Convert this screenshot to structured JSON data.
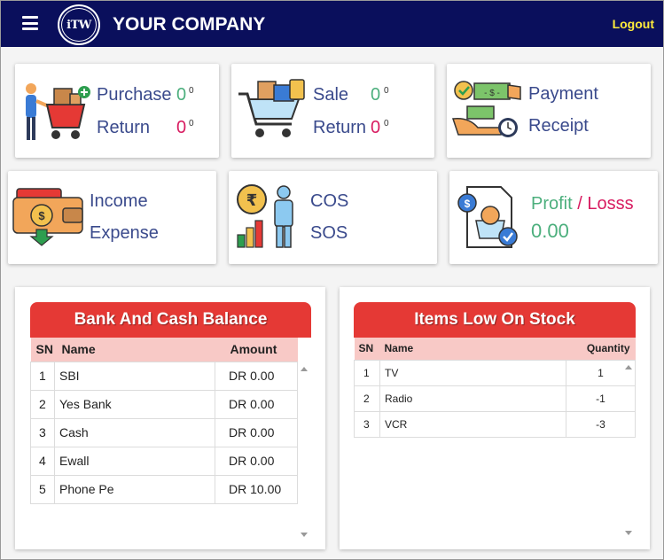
{
  "header": {
    "logo_text": "iTW",
    "company": "YOUR COMPANY",
    "logout": "Logout"
  },
  "cards": {
    "purchase": {
      "label1": "Purchase",
      "value1": "0",
      "sup1": "0",
      "label2": "Return",
      "value2": "0",
      "sup2": "0"
    },
    "sale": {
      "label1": "Sale",
      "value1": "0",
      "sup1": "0",
      "label2": "Return",
      "value2": "0",
      "sup2": "0"
    },
    "payment": {
      "label1": "Payment",
      "label2": "Receipt"
    },
    "income": {
      "label1": "Income",
      "label2": "Expense"
    },
    "cos": {
      "label1": "COS",
      "label2": "SOS"
    },
    "profit": {
      "label_profit": "Profit",
      "slash": " / ",
      "label_loss": "Losss",
      "value": "0.00"
    }
  },
  "bank": {
    "title": "Bank And Cash Balance",
    "headers": [
      "SN",
      "Name",
      "Amount"
    ],
    "rows": [
      {
        "sn": "1",
        "name": "SBI",
        "amount": "DR 0.00"
      },
      {
        "sn": "2",
        "name": "Yes Bank",
        "amount": "DR 0.00"
      },
      {
        "sn": "3",
        "name": "Cash",
        "amount": "DR 0.00"
      },
      {
        "sn": "4",
        "name": "Ewall",
        "amount": "DR 0.00"
      },
      {
        "sn": "5",
        "name": "Phone Pe",
        "amount": "DR 10.00"
      }
    ]
  },
  "stock": {
    "title": "Items Low On Stock",
    "headers": [
      "SN",
      "Name",
      "Quantity"
    ],
    "rows": [
      {
        "sn": "1",
        "name": "TV",
        "qty": "1"
      },
      {
        "sn": "2",
        "name": "Radio",
        "qty": "-1"
      },
      {
        "sn": "3",
        "name": "VCR",
        "qty": "-3"
      }
    ]
  },
  "colors": {
    "navbar": "#0a0f5c",
    "logout": "#ffeb3b",
    "panel_header": "#e53935",
    "table_header": "#f8c9c6",
    "label": "#3a4a8c",
    "green": "#4caf7d",
    "pink": "#d81b60"
  }
}
